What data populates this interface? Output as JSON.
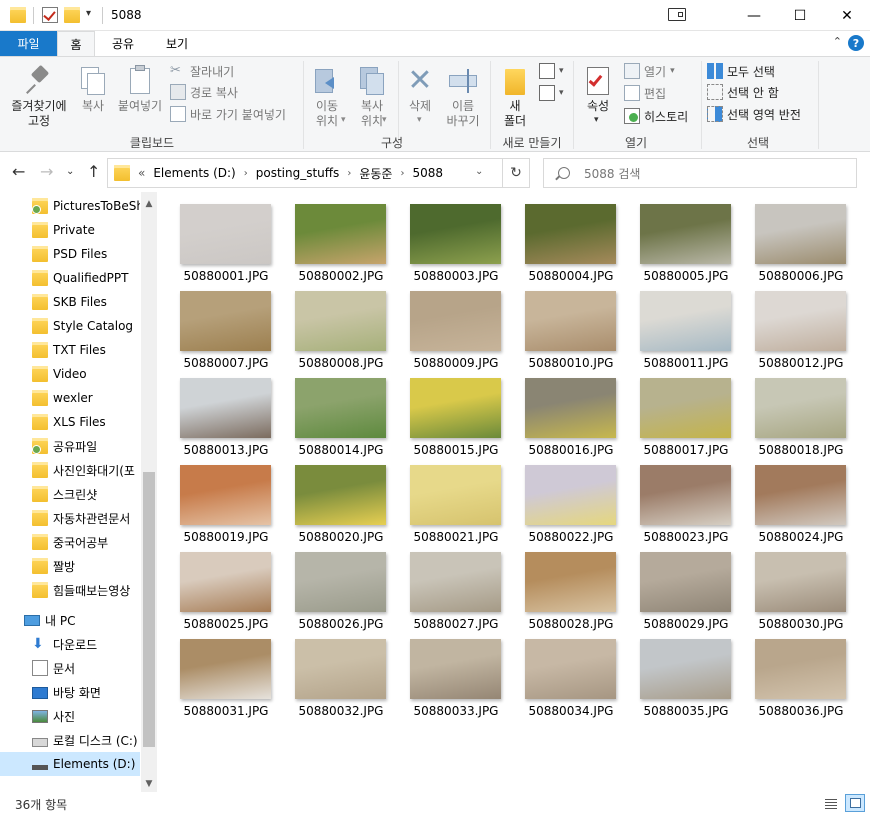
{
  "titlebar": {
    "title": "5088",
    "dropdown_glyph": "▾",
    "min_glyph": "—",
    "max_glyph": "☐",
    "close_glyph": "✕"
  },
  "ribbon_tabs": {
    "file": "파일",
    "items": [
      "홈",
      "공유",
      "보기"
    ],
    "active": "홈",
    "help": "?",
    "collapse_glyph": "⌃"
  },
  "ribbon": {
    "clipboard": {
      "pin_quick": "즐겨찾기에\n고정",
      "copy": "복사",
      "paste": "붙여넣기",
      "cut": "잘라내기",
      "copy_path": "경로 복사",
      "paste_shortcut": "바로 가기 붙여넣기",
      "label": "클립보드"
    },
    "organize": {
      "move_to": "이동\n위치",
      "copy_to": "복사\n위치",
      "delete": "삭제",
      "rename": "이름\n바꾸기",
      "label": "구성"
    },
    "new": {
      "new_folder": "새\n폴더",
      "label": "새로 만들기"
    },
    "open": {
      "properties": "속성",
      "open": "열기",
      "edit": "편집",
      "history": "히스토리",
      "label": "열기"
    },
    "select": {
      "select_all": "모두 선택",
      "select_none": "선택 안 함",
      "invert": "선택 영역 반전",
      "label": "선택"
    },
    "dropdown_glyph": "▾"
  },
  "address": {
    "prefix": "«",
    "crumbs": [
      "Elements (D:)",
      "posting_stuffs",
      "윤동준",
      "5088"
    ],
    "sep": "›",
    "drop_glyph": "⌄",
    "refresh_glyph": "↻"
  },
  "nav_glyphs": {
    "back": "←",
    "forward": "→",
    "recent": "⌄",
    "up": "↑"
  },
  "search": {
    "placeholder": "5088 검색"
  },
  "sidebar": {
    "items": [
      {
        "label": "PicturesToBeSha",
        "icon": "shared-folder-icon"
      },
      {
        "label": "Private",
        "icon": "folder-icon"
      },
      {
        "label": "PSD Files",
        "icon": "folder-icon"
      },
      {
        "label": "QualifiedPPT",
        "icon": "folder-icon"
      },
      {
        "label": "SKB Files",
        "icon": "folder-icon"
      },
      {
        "label": "Style Catalog",
        "icon": "folder-icon"
      },
      {
        "label": "TXT Files",
        "icon": "folder-icon"
      },
      {
        "label": "Video",
        "icon": "folder-icon"
      },
      {
        "label": "wexler",
        "icon": "folder-icon"
      },
      {
        "label": "XLS Files",
        "icon": "folder-icon"
      },
      {
        "label": "공유파일",
        "icon": "shared-folder-icon"
      },
      {
        "label": "사진인화대기(포",
        "icon": "folder-icon"
      },
      {
        "label": "스크린샷",
        "icon": "folder-icon"
      },
      {
        "label": "자동차관련문서",
        "icon": "folder-icon"
      },
      {
        "label": "중국어공부",
        "icon": "folder-icon"
      },
      {
        "label": "짤방",
        "icon": "folder-icon"
      },
      {
        "label": "힘들때보는영상",
        "icon": "folder-icon"
      }
    ],
    "this_pc": "내 PC",
    "pc_items": [
      {
        "label": "다운로드",
        "icon": "download-icon"
      },
      {
        "label": "문서",
        "icon": "document-icon"
      },
      {
        "label": "바탕 화면",
        "icon": "desktop-icon"
      },
      {
        "label": "사진",
        "icon": "pictures-icon"
      },
      {
        "label": "로컬 디스크 (C:)",
        "icon": "drive-icon"
      },
      {
        "label": "Elements (D:)",
        "icon": "usb-drive-icon"
      }
    ],
    "scroll_up": "▲",
    "scroll_down": "▼"
  },
  "files": [
    "50880001.JPG",
    "50880002.JPG",
    "50880003.JPG",
    "50880004.JPG",
    "50880005.JPG",
    "50880006.JPG",
    "50880007.JPG",
    "50880008.JPG",
    "50880009.JPG",
    "50880010.JPG",
    "50880011.JPG",
    "50880012.JPG",
    "50880013.JPG",
    "50880014.JPG",
    "50880015.JPG",
    "50880016.JPG",
    "50880017.JPG",
    "50880018.JPG",
    "50880019.JPG",
    "50880020.JPG",
    "50880021.JPG",
    "50880022.JPG",
    "50880023.JPG",
    "50880024.JPG",
    "50880025.JPG",
    "50880026.JPG",
    "50880027.JPG",
    "50880028.JPG",
    "50880029.JPG",
    "50880030.JPG",
    "50880031.JPG",
    "50880032.JPG",
    "50880033.JPG",
    "50880034.JPG",
    "50880035.JPG",
    "50880036.JPG"
  ],
  "thumb_colors": [
    [
      "#d3cfcc",
      "#cbc7c4"
    ],
    [
      "#6c8a3a",
      "#c7a46c"
    ],
    [
      "#4e6a2e",
      "#8da04e"
    ],
    [
      "#5b6a2f",
      "#a58a5b"
    ],
    [
      "#6d7448",
      "#b9b7a7"
    ],
    [
      "#c8c5bf",
      "#9b8c6e"
    ],
    [
      "#b6a07a",
      "#9c7f4f"
    ],
    [
      "#c9c5a6",
      "#a6b07a"
    ],
    [
      "#b7a489",
      "#c7b49a"
    ],
    [
      "#c8b59a",
      "#a98d6c"
    ],
    [
      "#dcdad4",
      "#a6b9c4"
    ],
    [
      "#ddd8d3",
      "#bfae9d"
    ],
    [
      "#cfd3d6",
      "#7b6b5e"
    ],
    [
      "#8ca36c",
      "#5e8a3e"
    ],
    [
      "#d9c94a",
      "#6b8a3a"
    ],
    [
      "#8a8573",
      "#c7b84e"
    ],
    [
      "#b7b28e",
      "#c4b44a"
    ],
    [
      "#c7c7b5",
      "#a7a682"
    ],
    [
      "#c77b4a",
      "#e5c3a6"
    ],
    [
      "#7a8c3d",
      "#e7cf52"
    ],
    [
      "#e7d98a",
      "#d6c36e"
    ],
    [
      "#cfc9d6",
      "#e5d77e"
    ],
    [
      "#9b7c68",
      "#d6cfc4"
    ],
    [
      "#a27a5c",
      "#d1c9c0"
    ],
    [
      "#d9cbbd",
      "#a67c55"
    ],
    [
      "#b6b5a9",
      "#9a9b8b"
    ],
    [
      "#c9c4b8",
      "#a59a86"
    ],
    [
      "#b58d5d",
      "#d8c3a2"
    ],
    [
      "#b5aa9b",
      "#8f8576"
    ],
    [
      "#c8bfb0",
      "#9b8c7a"
    ],
    [
      "#ab8d66",
      "#e6e2dc"
    ],
    [
      "#cbbfa8",
      "#b3a38a"
    ],
    [
      "#c1b5a1",
      "#958674"
    ],
    [
      "#c7b8a5",
      "#a69682"
    ],
    [
      "#c2c6c9",
      "#a89d8b"
    ],
    [
      "#b9a68c",
      "#d3c4ae"
    ]
  ],
  "status": {
    "count": "36개 항목"
  }
}
